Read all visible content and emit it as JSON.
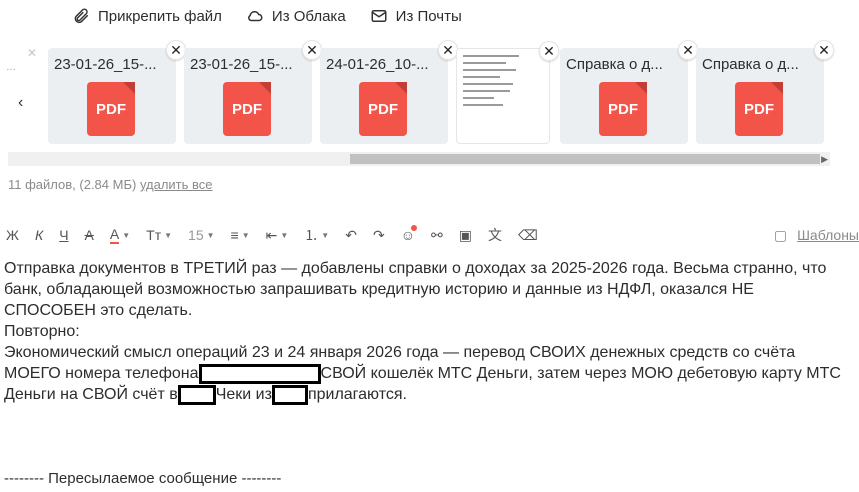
{
  "attach_bar": {
    "attach_file": "Прикрепить файл",
    "from_cloud": "Из Облака",
    "from_mail": "Из Почты"
  },
  "attachments": [
    {
      "name": "23-01-26_15-...",
      "type": "PDF"
    },
    {
      "name": "23-01-26_15-...",
      "type": "PDF"
    },
    {
      "name": "24-01-26_10-...",
      "type": "PDF"
    },
    {
      "name": "",
      "type": "document-preview"
    },
    {
      "name": "Справка о д...",
      "type": "PDF"
    },
    {
      "name": "Справка о д...",
      "type": "PDF"
    }
  ],
  "files_info": {
    "summary": "11 файлов, (2.84 МБ)",
    "delete_all": "удалить все"
  },
  "toolbar": {
    "bold": "Ж",
    "italic": "К",
    "underline": "Ч",
    "strike": "А",
    "color": "А",
    "font": "Тт",
    "size": "15",
    "templates": "Шаблоны"
  },
  "body": {
    "line1": "Отправка документов в ТРЕТИЙ раз — добавлены справки о доходах за 2025-2026 года. Весьма странно, что банк, обладающей возможностью запрашивать кредитную историю и данные из НДФЛ, оказался НЕ СПОСОБЕН это сделать.",
    "line2": "Повторно:",
    "line3a": "Экономический смысл операций 23 и 24 января 2026 года — перевод СВОИХ денежных средств со счёта МОЕГО номера телефона",
    "line3b": "СВОЙ кошелёк МТС Деньги, затем через МОЮ дебетовую карту МТС Деньги на СВОЙ счёт в",
    "line3c": "Чеки из",
    "line3d": "прилагаются."
  },
  "forwarded": "-------- Пересылаемое сообщение --------",
  "colors": {
    "pdf": "#f2544a",
    "card_bg": "#eceff1",
    "accent": "#f2544a"
  }
}
